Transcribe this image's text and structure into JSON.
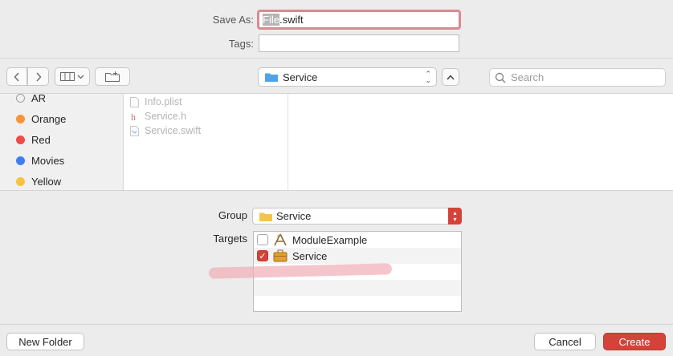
{
  "save": {
    "label": "Save As:",
    "value_selected": "File",
    "value_rest": ".swift"
  },
  "tags": {
    "label": "Tags:",
    "value": ""
  },
  "toolbar": {
    "location": "Service",
    "search_placeholder": "Search"
  },
  "sidebar": {
    "items": [
      {
        "label": "AR",
        "color": "#e8e8e8"
      },
      {
        "label": "Orange",
        "color": "#f5963c"
      },
      {
        "label": "Red",
        "color": "#f04a4a"
      },
      {
        "label": "Movies",
        "color": "#3f7ef0"
      },
      {
        "label": "Yellow",
        "color": "#f6c43c"
      }
    ]
  },
  "files": [
    {
      "name": "Info.plist",
      "icon": "plist-file-icon"
    },
    {
      "name": "Service.h",
      "icon": "header-file-icon"
    },
    {
      "name": "Service.swift",
      "icon": "swift-file-icon"
    }
  ],
  "group": {
    "label": "Group",
    "value": "Service"
  },
  "targets": {
    "label": "Targets",
    "items": [
      {
        "name": "ModuleExample",
        "checked": false,
        "icon": "app-target-icon"
      },
      {
        "name": "Service",
        "checked": true,
        "icon": "framework-target-icon"
      }
    ]
  },
  "buttons": {
    "new_folder": "New Folder",
    "cancel": "Cancel",
    "create": "Create"
  },
  "colors": {
    "accent": "#d3433a",
    "annotation": "#f1b2bb"
  }
}
